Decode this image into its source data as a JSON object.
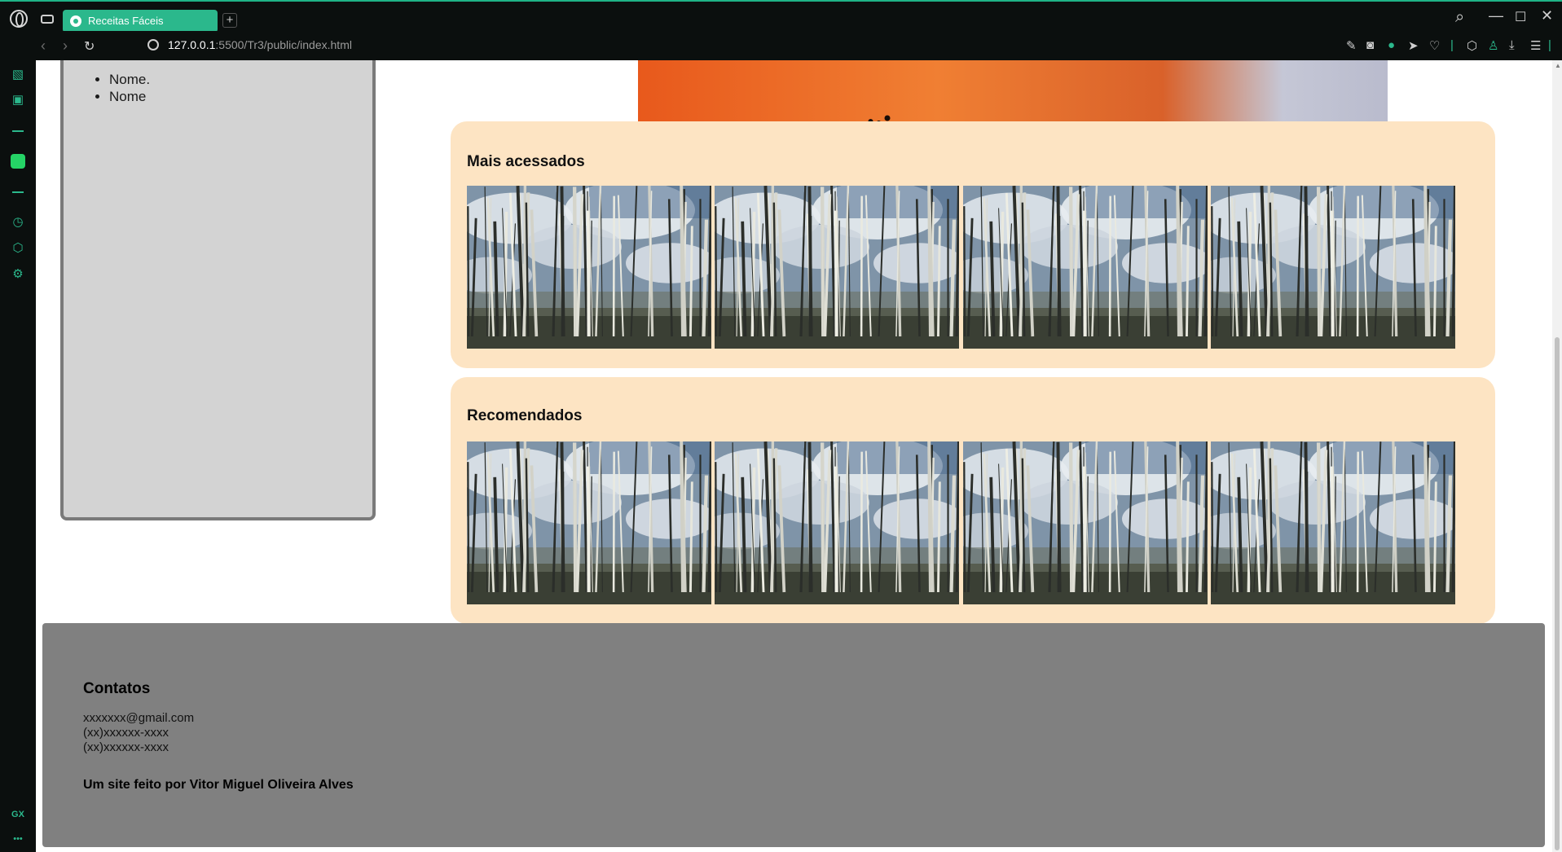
{
  "browser": {
    "tab_title": "Receitas Fáceis",
    "new_tab": "+",
    "url_host": "127.0.0.1",
    "url_path": ":5500/Tr3/public/index.html",
    "sidebar_bottom_label": "GX",
    "sidebar_more": "•••",
    "controls": {
      "minimize": "—",
      "maximize": "☐",
      "close": "✕",
      "search": "⌕"
    }
  },
  "page": {
    "sidebar_list": [
      "Nome.",
      "Nome"
    ],
    "sections": [
      {
        "title": "Mais acessados",
        "image_count": 4
      },
      {
        "title": "Recomendados",
        "image_count": 4
      }
    ],
    "footer": {
      "heading": "Contatos",
      "email": "xxxxxxx@gmail.com",
      "phone1": "(xx)xxxxxx-xxxx",
      "phone2": "(xx)xxxxxx-xxxx",
      "credit": "Um site feito por Vitor Miguel Oliveira Alves"
    }
  },
  "colors": {
    "accent": "#2bb88c",
    "section_bg": "#fde4c3",
    "sidebar_box_bg": "#d3d3d3",
    "footer_bg": "#808080"
  }
}
